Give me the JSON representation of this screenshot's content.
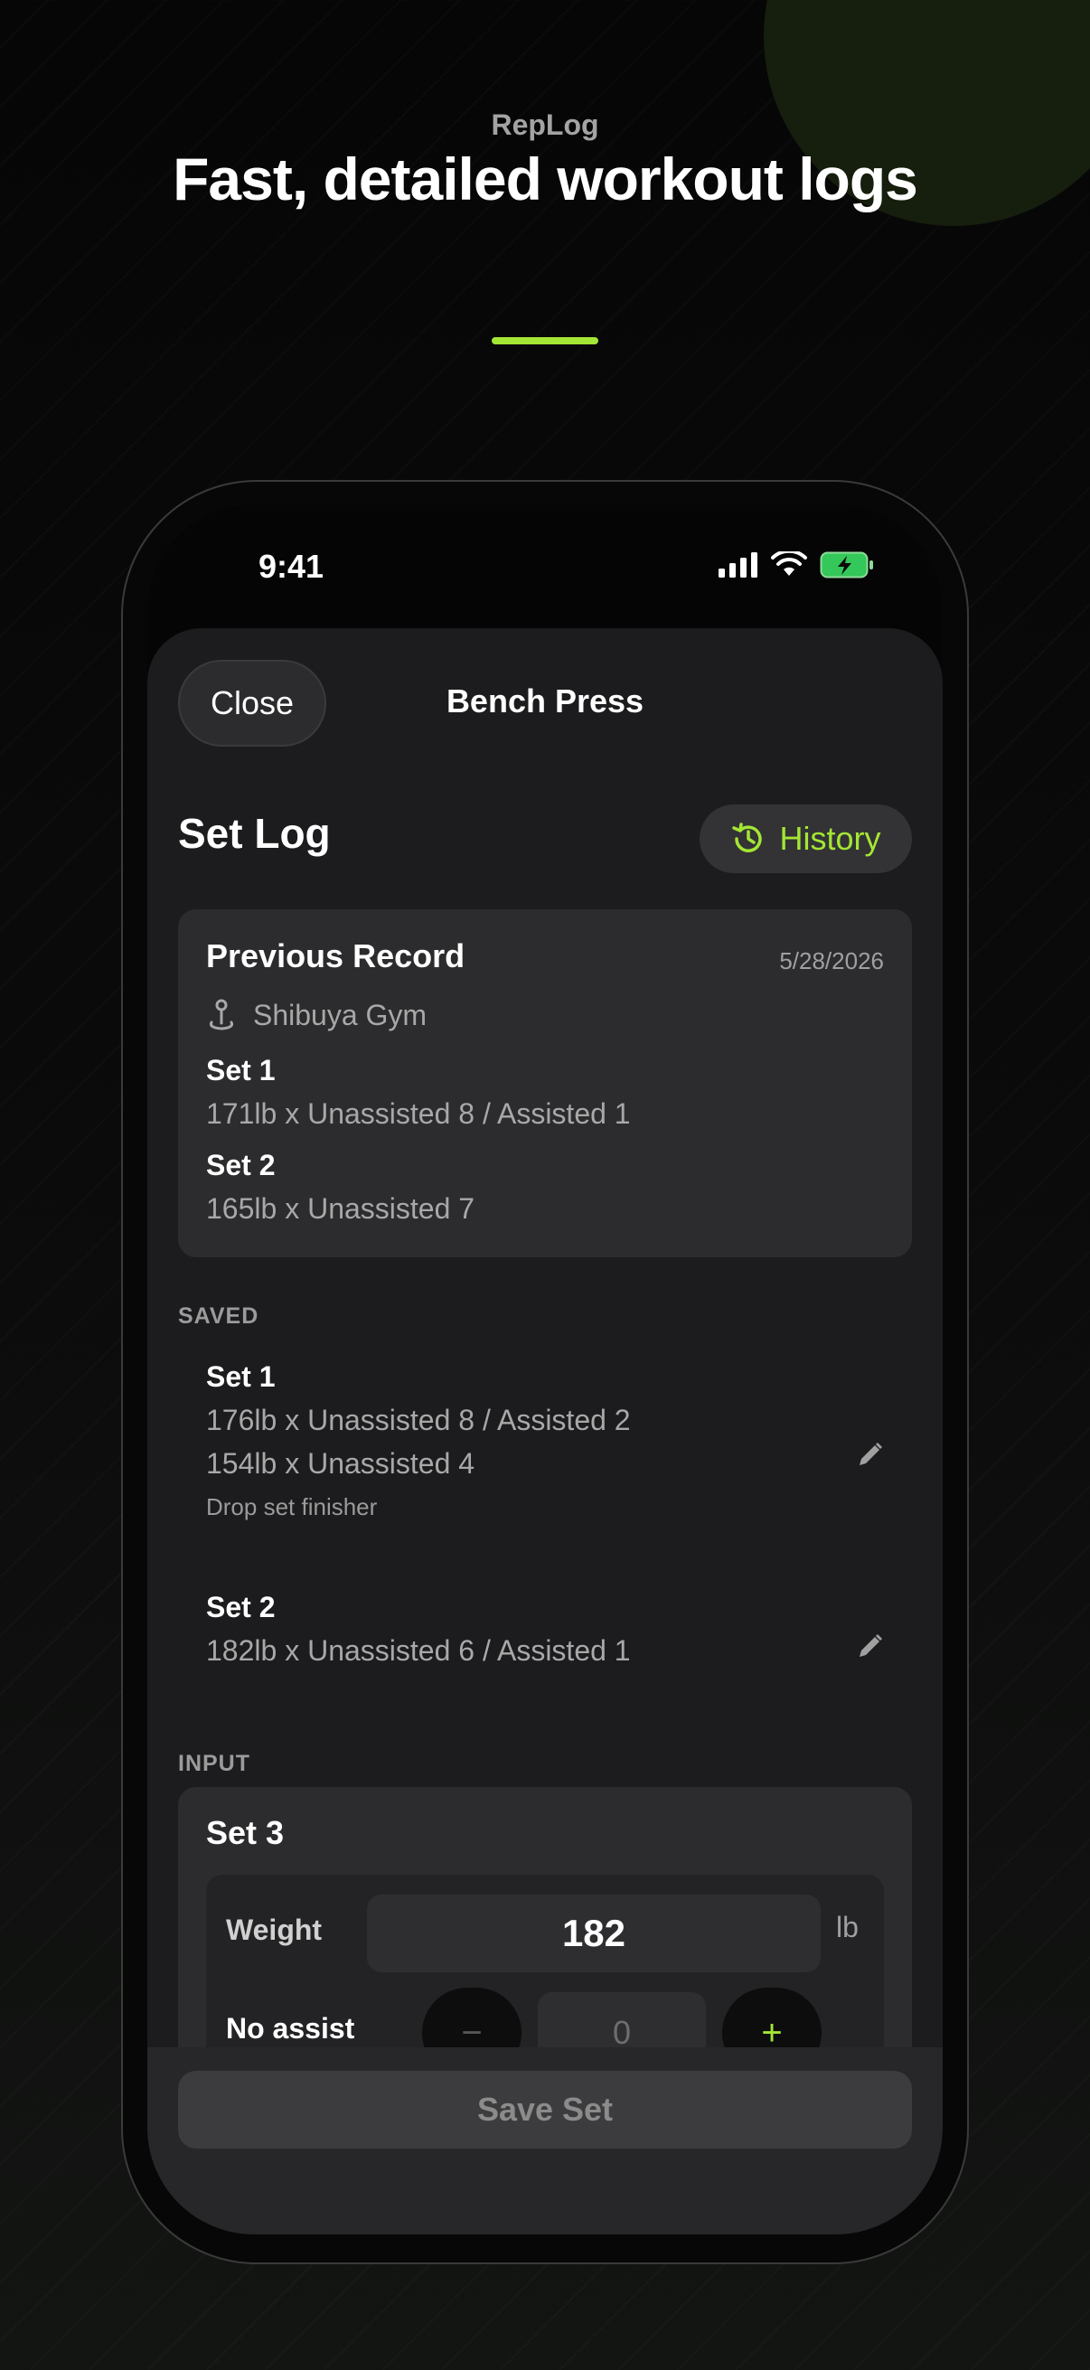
{
  "marketing": {
    "brand": "RepLog",
    "headline": "Fast, detailed workout logs",
    "accent_color": "#a4e635"
  },
  "status_bar": {
    "time": "9:41"
  },
  "sheet": {
    "close_label": "Close",
    "title": "Bench Press"
  },
  "set_log": {
    "title": "Set Log",
    "history_label": "History"
  },
  "previous_record": {
    "title": "Previous Record",
    "date": "5/28/2026",
    "gym": "Shibuya Gym",
    "sets": [
      {
        "label": "Set 1",
        "detail": "171lb x Unassisted 8 / Assisted 1"
      },
      {
        "label": "Set 2",
        "detail": "165lb x Unassisted 7"
      }
    ]
  },
  "saved": {
    "header": "SAVED",
    "sets": [
      {
        "label": "Set 1",
        "lines": [
          "176lb x Unassisted 8 / Assisted 2",
          "154lb x Unassisted 4"
        ],
        "note": "Drop set finisher"
      },
      {
        "label": "Set 2",
        "lines": [
          "182lb x Unassisted 6 / Assisted 1"
        ],
        "note": ""
      }
    ]
  },
  "input": {
    "header": "INPUT",
    "set_label": "Set 3",
    "weight_label": "Weight",
    "weight_value": "182",
    "weight_unit": "lb",
    "no_assist_label": "No assist",
    "no_assist_value": "0",
    "minus_symbol": "−",
    "plus_symbol": "+"
  },
  "save_button_label": "Save Set"
}
